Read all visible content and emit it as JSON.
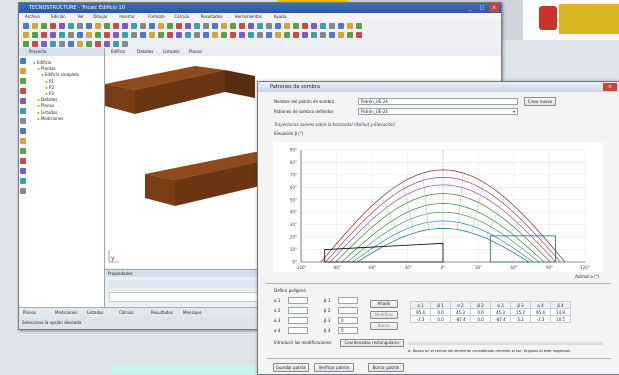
{
  "main_window": {
    "title": "TECNOSTRUCTURE - Tricalc Edificio 10",
    "menu": [
      "Archivo",
      "Edición",
      "Ver",
      "Dibujar",
      "Insertar",
      "Formato",
      "Cálculo",
      "Resultados",
      "Herramientas",
      "Ayuda"
    ],
    "project_panel": {
      "header": "Proyecto",
      "items": [
        "Edificio",
        "Plantas",
        "Edificio completo",
        "P1",
        "P2",
        "P3",
        "Detalles",
        "Planos",
        "Listados",
        "Mediciones"
      ]
    },
    "view_tabs": [
      "Edificio",
      "Detalles",
      "Listados",
      "Planos"
    ],
    "bottom_panel_header": "Propiedades",
    "bottom_tabs": [
      "Planos",
      "Mediciones",
      "Listados",
      "Cálculo",
      "Resultados",
      "Mensajes"
    ],
    "status": "Seleccione la opción deseada"
  },
  "dialog": {
    "title": "Patrones de sombra",
    "pattern_name_label": "Nombre del patrón de sombra",
    "pattern_name_value": "Patrón_UE-24",
    "defined_patterns_label": "Patrones de sombra definidos",
    "defined_patterns_value": "Patrón_UE-24",
    "create_button": "Crear nuevo",
    "section_label": "Trayectorias solares sobre la horizontal (Azimut y Elevación)",
    "y_axis_label": "Elevación β (°)",
    "x_axis_label": "Azimut α (°)",
    "define_polygon_label": "Definir polígono",
    "add_button": "Añadir",
    "modify_button": "Modificar",
    "delete_button": "Borrar",
    "intro_label": "Introducir las modificaciones",
    "coords_button": "Coordenadas rectangulares",
    "hint": "α: Ábaco en el centro del elemento considerado mirando al sur; Ángulos al este negativos",
    "save_button": "Guardar patrón",
    "verify_button": "Verificar patrón",
    "delete_pattern_button": "Borrar patrón",
    "alpha_labels": [
      "α 1",
      "α 2",
      "α 3",
      "α 4"
    ],
    "beta_labels": [
      "β 1",
      "β 2",
      "β 3",
      "β 4"
    ],
    "beta_values": [
      "",
      "",
      "0",
      "0"
    ],
    "table": {
      "header": [
        "α 1",
        "β 1",
        "α 2",
        "β 2",
        "α 3",
        "β 3",
        "α 4",
        "β 4"
      ],
      "rows": [
        [
          "95.4",
          "0.0",
          "45.3",
          "0.0",
          "45.3",
          "15.2",
          "95.4",
          "14.8"
        ],
        [
          "-3.3",
          "0.0",
          "-87.4",
          "0.0",
          "-87.4",
          "5.2",
          "-3.3",
          "10.5"
        ]
      ]
    }
  },
  "chart_data": {
    "type": "line",
    "y_ticks": [
      "90°",
      "80°",
      "70°",
      "60°",
      "50°",
      "40°",
      "30°",
      "20°",
      "10°",
      "0°"
    ],
    "x_ticks": [
      "-120°",
      "-90°",
      "-60°",
      "-30°",
      "0°",
      "30°",
      "60°",
      "90°",
      "120°"
    ],
    "xlim": [
      -120,
      120
    ],
    "ylim": [
      0,
      90
    ],
    "series_peaks": [
      74,
      68,
      62,
      55,
      47,
      40,
      33,
      27
    ],
    "series_colors": [
      "#7d2a2a",
      "#b33c6a",
      "#9a4ea8",
      "#5a7a2a",
      "#2c8a3e",
      "#4a9a5a",
      "#2f8fb0",
      "#1b6d8a"
    ],
    "obstacles": [
      {
        "alpha": [
          -100,
          -100,
          0,
          0
        ],
        "beta": [
          0,
          10,
          15,
          0
        ],
        "color": "#000000"
      },
      {
        "alpha": [
          40,
          40,
          95,
          95
        ],
        "beta": [
          0,
          21,
          21,
          0
        ],
        "color": "#1d5f7a"
      }
    ]
  },
  "colors": {
    "beam": "#7a3e15",
    "accent": "#2a5aa0"
  }
}
